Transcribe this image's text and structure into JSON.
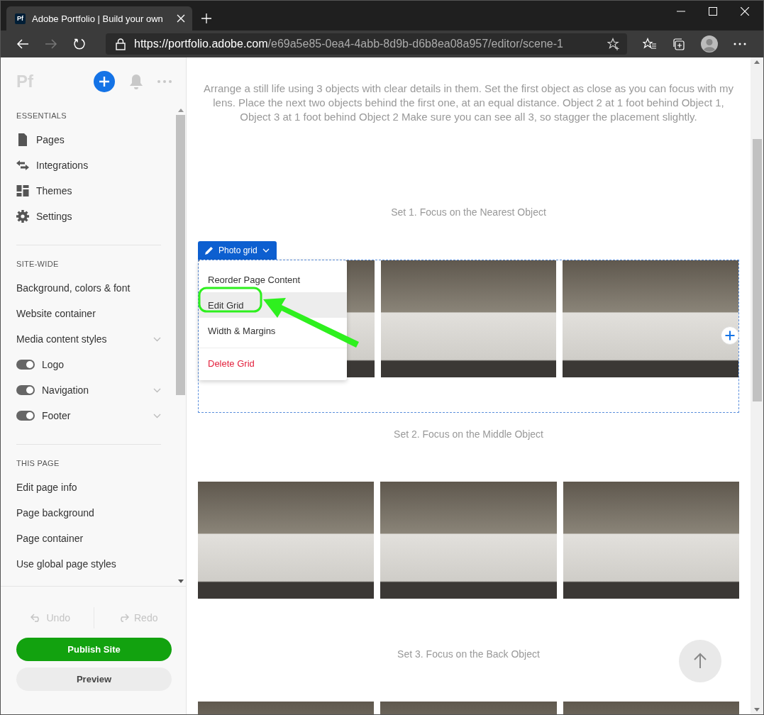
{
  "browser": {
    "tab_title": "Adobe Portfolio | Build your own",
    "tab_icon_text": "Pf",
    "url_host": "https://portfolio.adobe.com",
    "url_path": "/e69a5e85-0ea4-4abb-8d9b-d6b8ea08a957/editor/scene-1",
    "forward_disabled": true
  },
  "sidebar": {
    "logo": "Pf",
    "sections": [
      {
        "title": "ESSENTIALS",
        "items": [
          {
            "label": "Pages",
            "kind": "icon"
          },
          {
            "label": "Integrations",
            "kind": "icon"
          },
          {
            "label": "Themes",
            "kind": "icon"
          },
          {
            "label": "Settings",
            "kind": "icon"
          }
        ]
      },
      {
        "title": "SITE-WIDE",
        "items": [
          {
            "label": "Background, colors & font",
            "kind": "plain"
          },
          {
            "label": "Website container",
            "kind": "plain"
          },
          {
            "label": "Media content styles",
            "kind": "plain",
            "expandable": true
          },
          {
            "label": "Logo",
            "kind": "toggle",
            "on": true
          },
          {
            "label": "Navigation",
            "kind": "toggle",
            "on": true,
            "expandable": true
          },
          {
            "label": "Footer",
            "kind": "toggle",
            "on": true,
            "expandable": true
          }
        ]
      },
      {
        "title": "THIS PAGE",
        "items": [
          {
            "label": "Edit page info",
            "kind": "plain"
          },
          {
            "label": "Page background",
            "kind": "plain"
          },
          {
            "label": "Page container",
            "kind": "plain"
          },
          {
            "label": "Use global page styles",
            "kind": "plain"
          }
        ]
      }
    ],
    "undo": {
      "label": "Undo",
      "disabled": true
    },
    "redo": {
      "label": "Redo",
      "disabled": true
    },
    "publish": "Publish Site",
    "preview": "Preview"
  },
  "content": {
    "intro": "Arrange a still life using 3 objects with clear details in them. Set the first object as close as you can focus with my lens. Place the next two objects behind the first one, at an equal distance. Object 2 at 1 foot behind Object 1, Object 3 at 1 foot behind Object 2 Make sure you can see all 3, so stagger the placement slightly.",
    "sets": [
      {
        "title": "Set 1. Focus on the Nearest Object",
        "editing": true
      },
      {
        "title": "Set 2. Focus on the Middle Object",
        "editing": false
      },
      {
        "title": "Set 3. Focus on the Back Object",
        "editing": false
      }
    ],
    "toolbar": {
      "label": "Photo grid"
    },
    "menu": [
      {
        "label": "Reorder Page Content",
        "kind": "normal",
        "selected": false
      },
      {
        "label": "Edit Grid",
        "kind": "normal",
        "selected": true
      },
      {
        "label": "Width & Margins",
        "kind": "normal",
        "selected": false
      },
      {
        "label": "Delete Grid",
        "kind": "danger",
        "selected": false
      }
    ]
  }
}
